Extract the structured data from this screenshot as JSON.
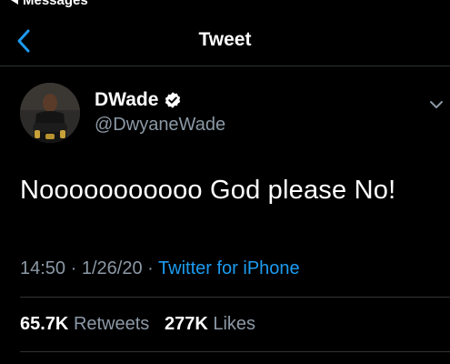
{
  "status_bar": {
    "back_app_label": "Messages"
  },
  "header": {
    "title": "Tweet",
    "back_icon": "chevron-left-icon"
  },
  "author": {
    "display_name": "DWade",
    "handle": "@DwyaneWade",
    "verified_icon": "verified-badge-icon",
    "more_icon": "chevron-down-icon"
  },
  "tweet": {
    "text": "Nooooooooooo God please No!",
    "time": "14:50",
    "separator": "·",
    "date": "1/26/20",
    "source": "Twitter for iPhone"
  },
  "stats": {
    "retweets_count": "65.7K",
    "retweets_label": "Retweets",
    "likes_count": "277K",
    "likes_label": "Likes"
  },
  "colors": {
    "background": "#000000",
    "accent": "#1d9bf0",
    "secondary_text": "#8b98a5",
    "divider": "#2f3336"
  }
}
